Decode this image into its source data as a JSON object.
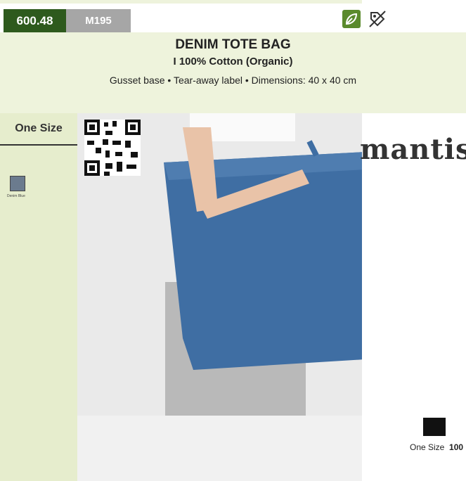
{
  "header": {
    "product_code": "600.48",
    "reference": "M195",
    "title": "DENIM TOTE BAG",
    "subtitle": "I 100% Cotton (Organic)",
    "features": "Gusset base • Tear-away label • Dimensions: 40 x 40 cm"
  },
  "sidebar": {
    "size_label": "One Size",
    "colors": [
      {
        "name": "Denim Blue",
        "hex": "#6b7b8e"
      }
    ]
  },
  "brand": {
    "logo": "mantis"
  },
  "sizes": [
    {
      "label": "One Size",
      "quantity": "100"
    }
  ],
  "icons": [
    "organic-leaf-icon",
    "tear-away-label-icon",
    "qr-code",
    "size-bag-icon"
  ]
}
